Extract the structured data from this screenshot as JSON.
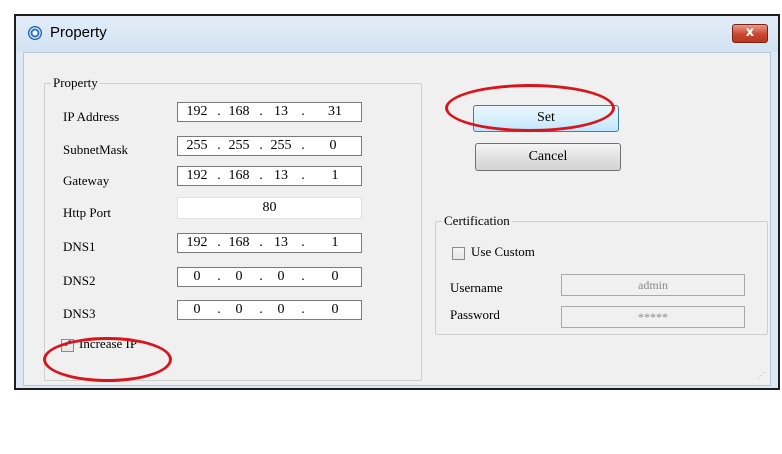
{
  "window": {
    "title": "Property",
    "close_glyph": "x"
  },
  "property_group": {
    "title": "Property",
    "fields": [
      {
        "label": "IP Address",
        "octets": [
          "192",
          "168",
          "13",
          "31"
        ]
      },
      {
        "label": "SubnetMask",
        "octets": [
          "255",
          "255",
          "255",
          "0"
        ]
      },
      {
        "label": "Gateway",
        "octets": [
          "192",
          "168",
          "13",
          "1"
        ]
      }
    ],
    "http_port": {
      "label": "Http Port",
      "value": "80"
    },
    "dns": [
      {
        "label": "DNS1",
        "octets": [
          "192",
          "168",
          "13",
          "1"
        ]
      },
      {
        "label": "DNS2",
        "octets": [
          "0",
          "0",
          "0",
          "0"
        ]
      },
      {
        "label": "DNS3",
        "octets": [
          "0",
          "0",
          "0",
          "0"
        ]
      }
    ],
    "increase_ip": {
      "label": "Increase IP",
      "checked": true
    }
  },
  "buttons": {
    "set_label": "Set",
    "cancel_label": "Cancel"
  },
  "certification": {
    "title": "Certification",
    "use_custom": {
      "label": "Use Custom",
      "checked": false
    },
    "username": {
      "label": "Username",
      "value": "admin"
    },
    "password": {
      "label": "Password",
      "value": "*****"
    }
  },
  "highlight_color": "#d9141b"
}
